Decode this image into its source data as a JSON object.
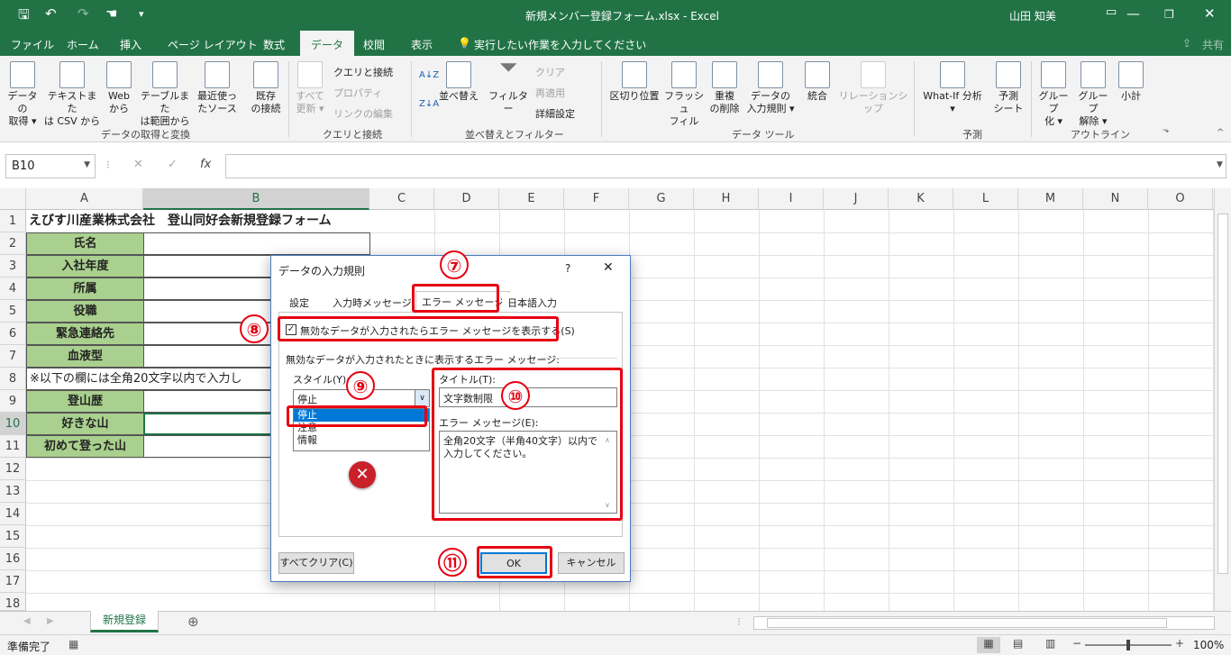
{
  "window": {
    "title": "新規メンバー登録フォーム.xlsx - Excel",
    "user": "山田 知美"
  },
  "tabs": [
    "ファイル",
    "ホーム",
    "挿入",
    "ページ レイアウト",
    "数式",
    "データ",
    "校閲",
    "表示"
  ],
  "tell_me": "実行したい作業を入力してください",
  "share": "共有",
  "ribbon": {
    "get_data": [
      "データの",
      "取得 ▾"
    ],
    "from_csv": [
      "テキストまた",
      "は CSV から"
    ],
    "from_web": [
      "Web",
      "から"
    ],
    "from_table": [
      "テーブルまた",
      "は範囲から"
    ],
    "recent": [
      "最近使っ",
      "たソース"
    ],
    "existing": [
      "既存",
      "の接続"
    ],
    "refresh": [
      "すべて",
      "更新 ▾"
    ],
    "queries": "クエリと接続",
    "properties": "プロパティ",
    "edit_links": "リンクの編集",
    "group1": "データの取得と変換",
    "group2": "クエリと接続",
    "sort_az": "A↓Z",
    "sort_za": "Z↓A",
    "sort": "並べ替え",
    "filter": "フィルター",
    "clear": "クリア",
    "reapply": "再適用",
    "advanced": "詳細設定",
    "group3": "並べ替えとフィルター",
    "text_to_cols": "区切り位置",
    "flash_fill": [
      "フラッシュ",
      "フィル"
    ],
    "remove_dup": [
      "重複",
      "の削除"
    ],
    "validation": [
      "データの",
      "入力規則 ▾"
    ],
    "consolidate": "統合",
    "relationships": "リレーションシップ",
    "group4": "データ ツール",
    "whatif": [
      "What-If 分析",
      "▾"
    ],
    "forecast": [
      "予測",
      "シート"
    ],
    "group5": "予測",
    "grp": [
      "グループ",
      "化 ▾"
    ],
    "ungrp": [
      "グループ",
      "解除 ▾"
    ],
    "subtotal": "小計",
    "group6": "アウトライン"
  },
  "namebox": "B10",
  "fx": "fx",
  "columns": [
    "A",
    "B",
    "C",
    "D",
    "E",
    "F",
    "G",
    "H",
    "I",
    "J",
    "K",
    "L",
    "M",
    "N",
    "O"
  ],
  "rows": [
    "1",
    "2",
    "3",
    "4",
    "5",
    "6",
    "7",
    "8",
    "9",
    "10",
    "11",
    "12",
    "13",
    "14",
    "15",
    "16",
    "17",
    "18"
  ],
  "cells": {
    "title": "えびす川産業株式会社　登山同好会新規登録フォーム",
    "name": "氏名",
    "year": "入社年度",
    "dept": "所属",
    "position": "役職",
    "emergency": "緊急連絡先",
    "blood": "血液型",
    "note": "※以下の欄には全角20文字以内で入力し",
    "history": "登山歴",
    "fav": "好きな山",
    "first": "初めて登った山"
  },
  "sheet_tab": "新規登録",
  "status": "準備完了",
  "zoom": "100%",
  "dialog": {
    "title": "データの入力規則",
    "help": "?",
    "close": "✕",
    "tabs": [
      "設定",
      "入力時メッセージ",
      "エラー メッセージ",
      "日本語入力"
    ],
    "checkbox": "無効なデータが入力されたらエラー メッセージを表示する(S)",
    "section": "無効なデータが入力されたときに表示するエラー メッセージ:",
    "style_label": "スタイル(Y):",
    "style_value": "停止",
    "style_options": [
      "停止",
      "注意",
      "情報"
    ],
    "title_label": "タイトル(T):",
    "title_value": "文字数制限",
    "msg_label": "エラー メッセージ(E):",
    "msg_value": "全角20文字（半角40文字）以内で入力してください。",
    "clear_all": "すべてクリア(C)",
    "ok": "OK",
    "cancel": "キャンセル"
  },
  "badges": [
    "⑦",
    "⑧",
    "⑨",
    "⑩",
    "⑪"
  ],
  "accent": "#e60012",
  "excel_green": "#217346"
}
